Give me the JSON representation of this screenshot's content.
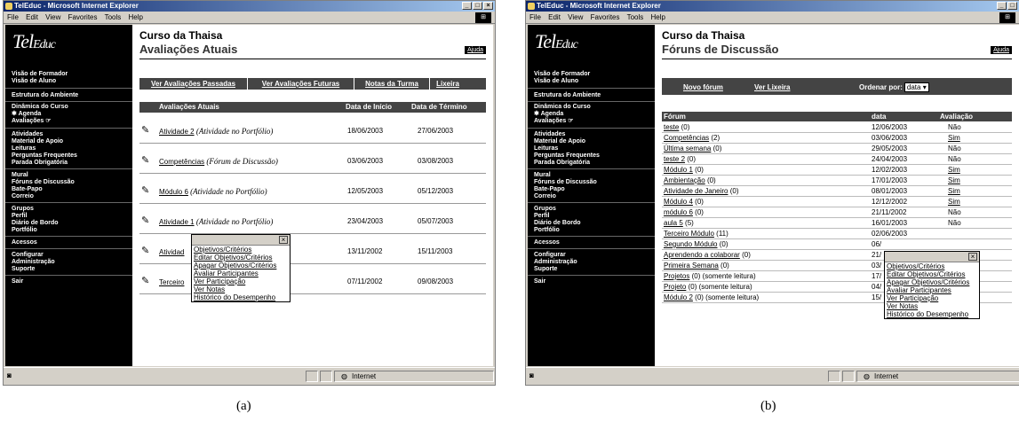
{
  "window": {
    "title": "TelEduc - Microsoft Internet Explorer",
    "menu": [
      "File",
      "Edit",
      "View",
      "Favorites",
      "Tools",
      "Help"
    ],
    "status_zone": "Internet"
  },
  "sidebar": {
    "logo": "Tel",
    "logo_small": "Educ",
    "view": [
      "Visão de Formador",
      "Visão de Aluno"
    ],
    "structure": [
      "Estrutura do Ambiente",
      "Dinâmica do Curso",
      "Agenda"
    ],
    "evaluations": "Avaliações",
    "activities": [
      "Atividades",
      "Material de Apoio",
      "Leituras",
      "Perguntas Frequentes",
      "Parada Obrigatória"
    ],
    "communication": [
      "Mural",
      "Fóruns de Discussão",
      "Bate-Papo",
      "Correio"
    ],
    "groups": [
      "Grupos",
      "Perfil",
      "Diário de Bordo",
      "Portfólio"
    ],
    "access": "Acessos",
    "admin": [
      "Configurar",
      "Administração",
      "Suporte"
    ],
    "exit": "Sair"
  },
  "screen_a": {
    "course": "Curso da Thaisa",
    "title": "Avaliações Atuais",
    "help": "Ajuda",
    "tabs": [
      "Ver Avaliações Passadas",
      "Ver Avaliações Futuras",
      "Notas da Turma",
      "Lixeira"
    ],
    "headers": [
      "Avaliações Atuais",
      "Data de Início",
      "Data de Término"
    ],
    "rows": [
      {
        "name": "Atividade 2",
        "type": "(Atividade no Portfólio)",
        "start": "18/06/2003",
        "end": "27/06/2003"
      },
      {
        "name": "Competências",
        "type": "(Fórum de Discussão)",
        "start": "03/06/2003",
        "end": "03/08/2003"
      },
      {
        "name": "Módulo 6",
        "type": "(Atividade no Portfólio)",
        "start": "12/05/2003",
        "end": "05/12/2003"
      },
      {
        "name": "Atividade 1",
        "type": "(Atividade no Portfólio)",
        "start": "23/04/2003",
        "end": "05/07/2003"
      },
      {
        "name": "Atividad",
        "type": "",
        "start": "13/11/2002",
        "end": "15/11/2003"
      },
      {
        "name": "Terceiro",
        "type": "",
        "start": "07/11/2002",
        "end": "09/08/2003"
      }
    ],
    "popup_close": "×",
    "popup": [
      "Objetivos/Critérios",
      "Editar Objetivos/Critérios",
      "Apagar Objetivos/Critérios",
      "Avaliar Participantes",
      "Ver Participação",
      "Ver Notas",
      "Histórico do Desempenho"
    ]
  },
  "screen_b": {
    "course": "Curso da Thaisa",
    "title": "Fóruns de Discussão",
    "help": "Ajuda",
    "new_forum": "Novo fórum",
    "trash": "Ver Lixeira",
    "order_label": "Ordenar por:",
    "order_value": "data",
    "headers": [
      "Fórum",
      "data",
      "Avaliação"
    ],
    "rows": [
      {
        "name": "teste",
        "count": "(0)",
        "date": "12/06/2003",
        "eval": "Não"
      },
      {
        "name": "Competências",
        "count": "(2)",
        "date": "03/06/2003",
        "eval": "Sim"
      },
      {
        "name": "Última semana",
        "count": "(0)",
        "date": "29/05/2003",
        "eval": "Não"
      },
      {
        "name": "teste 2",
        "count": "(0)",
        "date": "24/04/2003",
        "eval": "Não"
      },
      {
        "name": "Módulo 1",
        "count": "(0)",
        "date": "12/02/2003",
        "eval": "Sim"
      },
      {
        "name": "Ambientação",
        "count": "(0)",
        "date": "17/01/2003",
        "eval": "Sim"
      },
      {
        "name": "Atividade de Janeiro",
        "count": "(0)",
        "date": "08/01/2003",
        "eval": "Sim"
      },
      {
        "name": "Módulo 4",
        "count": "(0)",
        "date": "12/12/2002",
        "eval": "Sim"
      },
      {
        "name": "módulo 6",
        "count": "(0)",
        "date": "21/11/2002",
        "eval": "Não"
      },
      {
        "name": "aula 5",
        "count": "(5)",
        "date": "16/01/2003",
        "eval": "Não"
      },
      {
        "name": "Terceiro Módulo",
        "count": "(11)",
        "date": "02/06/2003",
        "eval": ""
      },
      {
        "name": "Segundo Módulo",
        "count": "(0)",
        "date": "06/",
        "eval": ""
      },
      {
        "name": "Aprendendo a colaborar",
        "count": "(0)",
        "date": "21/",
        "eval": ""
      },
      {
        "name": "Primeira Semana",
        "count": "(0)",
        "date": "03/",
        "eval": ""
      },
      {
        "name": "Projetos",
        "count": "(0) (somente leitura)",
        "date": "17/",
        "eval": ""
      },
      {
        "name": "Projeto",
        "count": "(0) (somente leitura)",
        "date": "04/",
        "eval": ""
      },
      {
        "name": "Módulo 2",
        "count": "(0) (somente leitura)",
        "date": "15/",
        "eval": ""
      }
    ],
    "popup_close": "×",
    "popup": [
      "Objetivos/Critérios",
      "Editar Objetivos/Critérios",
      "Apagar Objetivos/Critérios",
      "Avaliar Participantes",
      "Ver Participação",
      "Ver Notas",
      "Histórico do Desempenho"
    ]
  },
  "captions": [
    "(a)",
    "(b)"
  ]
}
